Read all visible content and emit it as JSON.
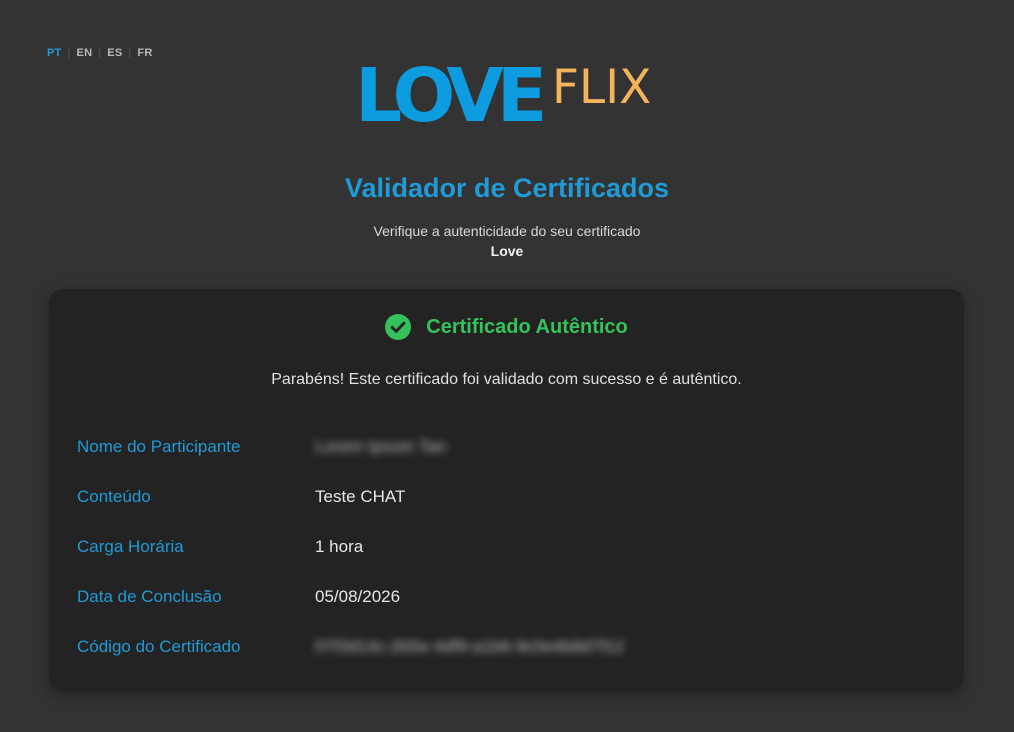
{
  "languages": [
    {
      "code": "PT",
      "active": true
    },
    {
      "code": "EN",
      "active": false
    },
    {
      "code": "ES",
      "active": false
    },
    {
      "code": "FR",
      "active": false
    }
  ],
  "logo": {
    "primary": "LOVE",
    "secondary": "FLIX",
    "primary_color": "#0d9ce0",
    "secondary_color": "#f5b35a"
  },
  "header": {
    "title": "Validador de Certificados",
    "subtitle": "Verifique a autenticidade do seu certificado",
    "brand_name": "Love"
  },
  "result": {
    "status_icon": "check-circle-icon",
    "status_text": "Certificado Autêntico",
    "status_color": "#34c35a",
    "message": "Parabéns! Este certificado foi validado com sucesso e é autêntico."
  },
  "fields": [
    {
      "label": "Nome do Participante",
      "value": "Lorem Ipsum Tan",
      "blurred": true
    },
    {
      "label": "Conteúdo",
      "value": "Teste CHAT",
      "blurred": false
    },
    {
      "label": "Carga Horária",
      "value": "1 hora",
      "blurred": false
    },
    {
      "label": "Data de Conclusão",
      "value": "05/08/2026",
      "blurred": false
    },
    {
      "label": "Código do Certificado",
      "value": "07f3d14c-2b5e-4df9-a1b6-9c0e4b8d7f12",
      "blurred": true
    }
  ],
  "colors": {
    "background": "#333333",
    "card": "#232323",
    "accent": "#1f9bd7"
  }
}
